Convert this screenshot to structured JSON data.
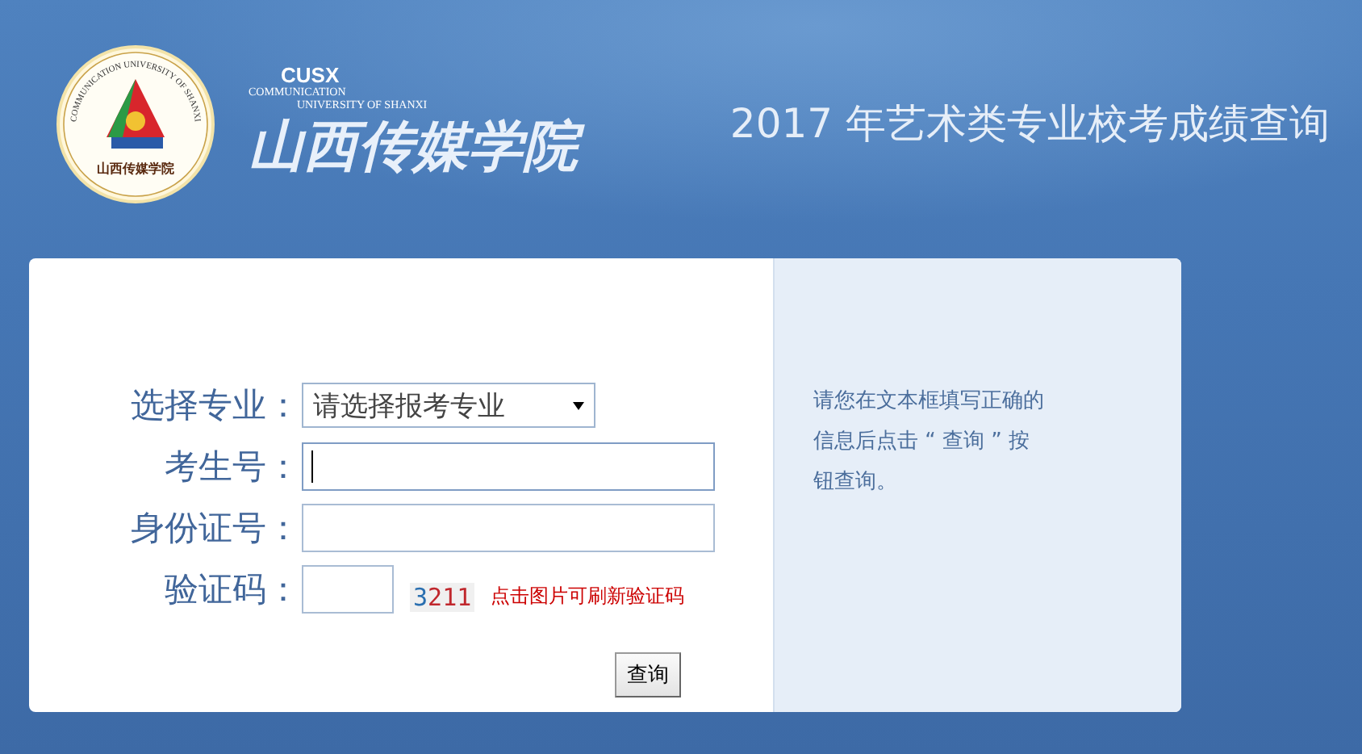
{
  "header": {
    "logo_ring_text": "COMMUNICATION UNIVERSITY OF SHANXI",
    "logo_bottom_text": "山西传媒学院",
    "abbr": "CUSX",
    "name_en_1": "COMMUNICATION",
    "name_en_2": "UNIVERSITY OF SHANXI",
    "name_cn": "山西传媒学院",
    "title": "2017 年艺术类专业校考成绩查询"
  },
  "form": {
    "fields": [
      {
        "kind": "select",
        "label": "选择专业：",
        "value": "请选择报考专业",
        "focused": false
      },
      {
        "kind": "text",
        "label": "考生号：",
        "focused": true
      },
      {
        "kind": "text",
        "label": "身份证号：",
        "focused": false
      },
      {
        "kind": "captcha",
        "label": "验证码：",
        "focused": false,
        "captcha": [
          {
            "char": "3",
            "color": "#2a6fb0"
          },
          {
            "char": "2",
            "color": "#c0272d"
          },
          {
            "char": "1",
            "color": "#c0272d"
          },
          {
            "char": "1",
            "color": "#c0272d"
          }
        ],
        "hint": "点击图片可刷新验证码"
      }
    ],
    "submit": "查询"
  },
  "help": {
    "text": "请您在文本框填写正确的信息后点击 “ 查询 ” 按钮查询。"
  }
}
